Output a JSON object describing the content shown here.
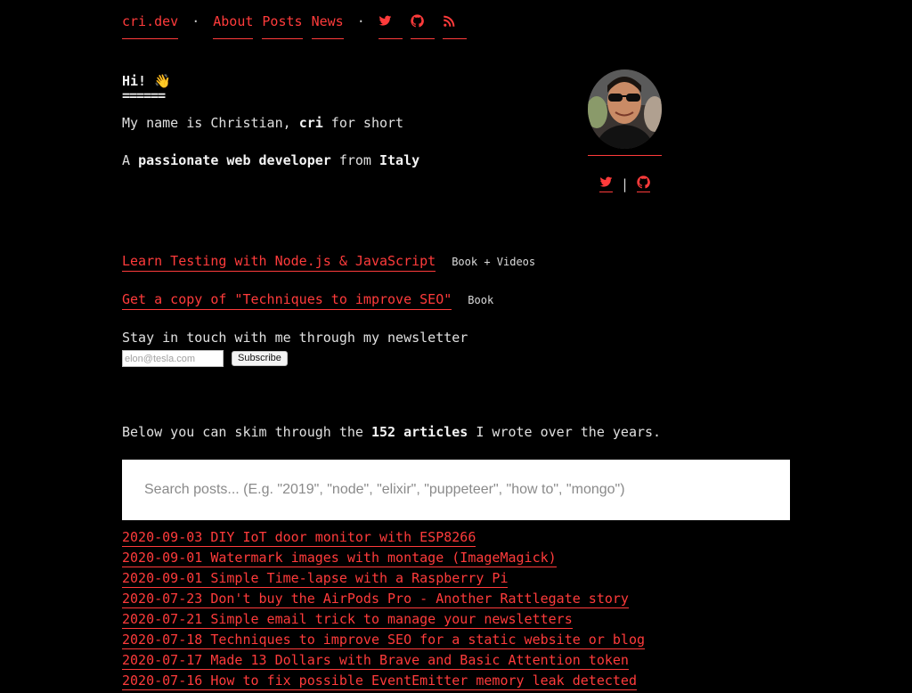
{
  "nav": {
    "brand": "cri.dev",
    "separator": "·",
    "links": [
      "About",
      "Posts",
      "News"
    ],
    "icons": [
      "twitter-icon",
      "github-icon",
      "rss-icon"
    ]
  },
  "intro": {
    "greeting": "Hi! 👋",
    "greeting_underline": "======",
    "name_prefix": "My name is Christian, ",
    "name_short": "cri",
    "name_suffix": " for short",
    "role_prefix": "A ",
    "role": "passionate web developer",
    "role_mid": " from ",
    "country": "Italy"
  },
  "avatar": {
    "separator": "|",
    "icons": [
      "twitter-icon",
      "github-icon"
    ]
  },
  "promos": [
    {
      "link": "Learn Testing with Node.js & JavaScript",
      "tag": "Book + Videos"
    },
    {
      "link": "Get a copy of \"Techniques to improve SEO\"",
      "tag": "Book"
    }
  ],
  "newsletter": {
    "text": "Stay in touch with me through my newsletter",
    "placeholder": "elon@tesla.com",
    "button": "Subscribe"
  },
  "articles": {
    "prefix": "Below you can skim through the ",
    "count": "152 articles",
    "suffix": " I wrote over the years."
  },
  "search": {
    "placeholder": "Search posts... (E.g. \"2019\", \"node\", \"elixir\", \"puppeteer\", \"how to\", \"mongo\")"
  },
  "posts": [
    "2020-09-03 DIY IoT door monitor with ESP8266",
    "2020-09-01 Watermark images with montage (ImageMagick)",
    "2020-09-01 Simple Time-lapse with a Raspberry Pi",
    "2020-07-23 Don't buy the AirPods Pro - Another Rattlegate story",
    "2020-07-21 Simple email trick to manage your newsletters",
    "2020-07-18 Techniques to improve SEO for a static website or blog",
    "2020-07-17 Made 13 Dollars with Brave and Basic Attention token",
    "2020-07-16 How to fix possible EventEmitter memory leak detected"
  ],
  "colors": {
    "background": "#000000",
    "accent": "#ff3b3b",
    "text": "#e8e8e8"
  }
}
